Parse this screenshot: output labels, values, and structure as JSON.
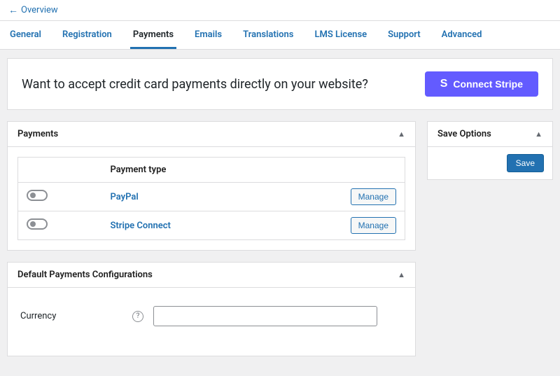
{
  "nav": {
    "overview": "Overview"
  },
  "tabs": [
    {
      "label": "General"
    },
    {
      "label": "Registration"
    },
    {
      "label": "Payments",
      "active": true
    },
    {
      "label": "Emails"
    },
    {
      "label": "Translations"
    },
    {
      "label": "LMS License"
    },
    {
      "label": "Support"
    },
    {
      "label": "Advanced"
    }
  ],
  "banner": {
    "text": "Want to accept credit card payments directly on your website?",
    "button": "Connect Stripe"
  },
  "payments_panel": {
    "title": "Payments",
    "col_type": "Payment type",
    "rows": [
      {
        "name": "PayPal",
        "action": "Manage"
      },
      {
        "name": "Stripe Connect",
        "action": "Manage"
      }
    ]
  },
  "config_panel": {
    "title": "Default Payments Configurations",
    "currency_label": "Currency",
    "currency_value": ""
  },
  "save_panel": {
    "title": "Save Options",
    "button": "Save"
  }
}
